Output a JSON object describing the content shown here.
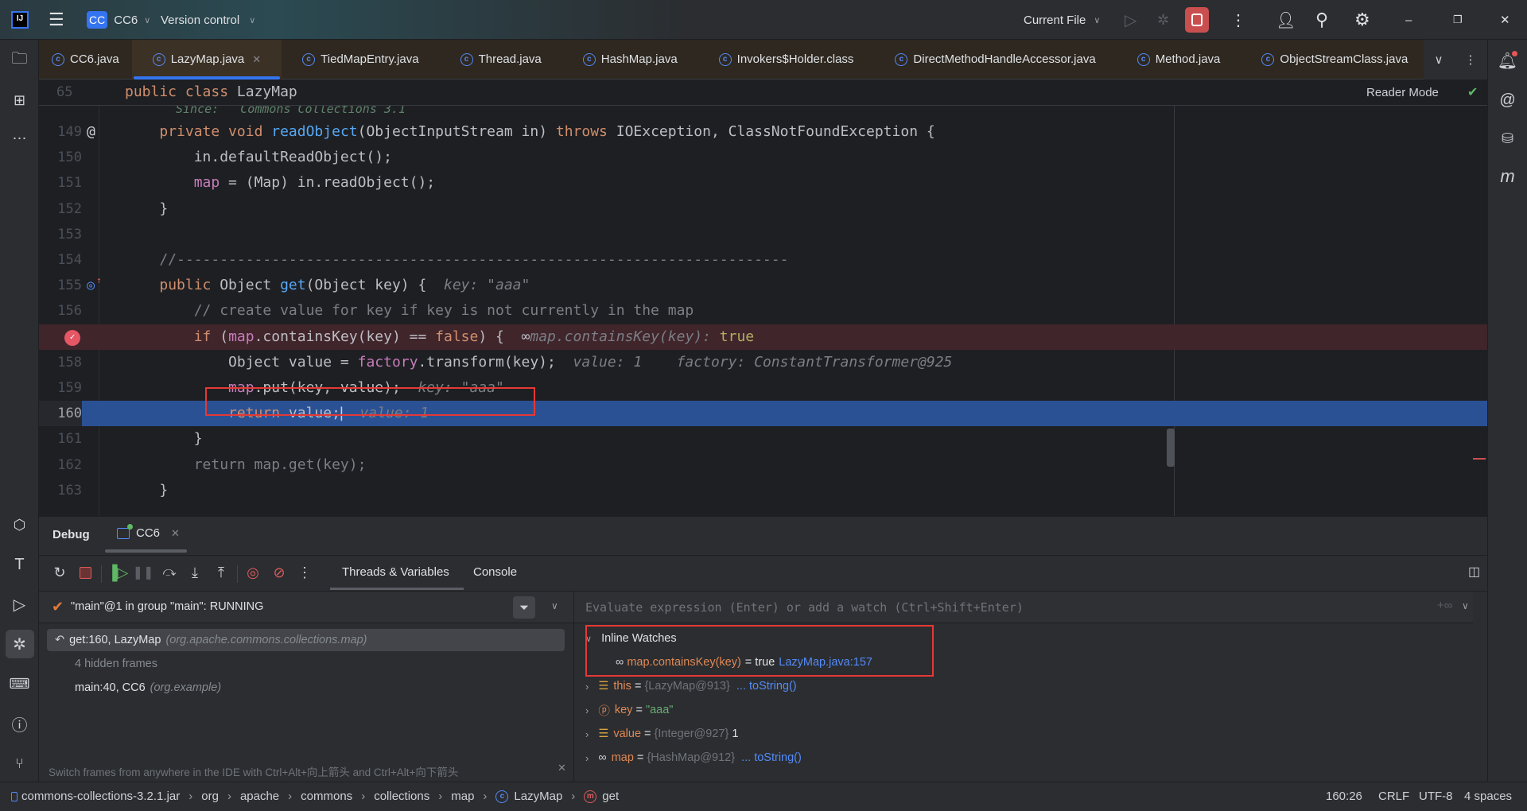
{
  "titlebar": {
    "logo": "IJ",
    "project_badge": "CC",
    "project": "CC6",
    "vcs": "Version control",
    "run_config": "Current File",
    "icons": [
      "hamburger-icon",
      "run-icon",
      "debug-icon",
      "stop-icon",
      "more-icon",
      "add-user-icon",
      "search-icon",
      "settings-icon",
      "minimize-icon",
      "restore-icon",
      "close-icon"
    ],
    "stop_color": "#c94f4f"
  },
  "tabs": [
    {
      "label": "CC6.java"
    },
    {
      "label": "LazyMap.java",
      "active": true
    },
    {
      "label": "TiedMapEntry.java"
    },
    {
      "label": "Thread.java"
    },
    {
      "label": "HashMap.java"
    },
    {
      "label": "Invokers$Holder.class"
    },
    {
      "label": "DirectMethodHandleAccessor.java"
    },
    {
      "label": "Method.java"
    },
    {
      "label": "ObjectStreamClass.java"
    }
  ],
  "editor": {
    "sticky_line_number": "65",
    "sticky_text": "public class LazyMap",
    "reader_mode": "Reader Mode",
    "doc_line": "Since:   Commons Collections 3.1",
    "lines": [
      {
        "n": "149",
        "gutter": "@",
        "tokens": [
          [
            "    ",
            "t"
          ],
          [
            "private void ",
            "k"
          ],
          [
            "readObject",
            "f"
          ],
          [
            "(ObjectInputStream in) ",
            "t"
          ],
          [
            "throws ",
            "k"
          ],
          [
            "IOException, ClassNotFoundException {",
            "t"
          ]
        ]
      },
      {
        "n": "150",
        "tokens": [
          [
            "        in.defaultReadObject();",
            "t"
          ]
        ]
      },
      {
        "n": "151",
        "tokens": [
          [
            "        ",
            "t"
          ],
          [
            "map",
            "v"
          ],
          [
            " = (Map) in.readObject();",
            "t"
          ]
        ]
      },
      {
        "n": "152",
        "tokens": [
          [
            "    }",
            "t"
          ]
        ]
      },
      {
        "n": "153",
        "tokens": []
      },
      {
        "n": "154",
        "tokens": [
          [
            "    //-----------------------------------------------------------------------",
            "c"
          ]
        ]
      },
      {
        "n": "155",
        "gutter": "override",
        "tokens": [
          [
            "    ",
            "t"
          ],
          [
            "public ",
            "k"
          ],
          [
            "Object ",
            "t"
          ],
          [
            "get",
            "f"
          ],
          [
            "(Object key) {  ",
            "t"
          ],
          [
            "key: \"aaa\"",
            "h"
          ]
        ]
      },
      {
        "n": "156",
        "tokens": [
          [
            "        // create value for key if key is not currently in the map",
            "c"
          ]
        ]
      },
      {
        "n": "",
        "gutter": "breakpoint",
        "style": "bp",
        "tokens": [
          [
            "        ",
            "t"
          ],
          [
            "if ",
            "k"
          ],
          [
            "(",
            "t"
          ],
          [
            "map",
            "v"
          ],
          [
            ".containsKey(key) == ",
            "t"
          ],
          [
            "false",
            "k"
          ],
          [
            ") {  ",
            "t"
          ],
          [
            "∞",
            "t"
          ],
          [
            "map.containsKey(key): ",
            "h"
          ],
          [
            "true",
            "y"
          ]
        ]
      },
      {
        "n": "158",
        "tokens": [
          [
            "            Object value = ",
            "t"
          ],
          [
            "factory",
            "v"
          ],
          [
            ".transform(key);  ",
            "t"
          ],
          [
            "value: 1    factory: ConstantTransformer@925",
            "h"
          ]
        ]
      },
      {
        "n": "159",
        "tokens": [
          [
            "            ",
            "t"
          ],
          [
            "map",
            "v"
          ],
          [
            ".put(key, value);  ",
            "t"
          ],
          [
            "key: \"aaa\"",
            "h"
          ]
        ]
      },
      {
        "n": "160",
        "style": "exec",
        "tokens": [
          [
            "            ",
            "t"
          ],
          [
            "return ",
            "k"
          ],
          [
            "value;",
            "t"
          ],
          [
            "|  ",
            "cur"
          ],
          [
            "value: 1",
            "h"
          ]
        ]
      },
      {
        "n": "161",
        "tokens": [
          [
            "        }",
            "t"
          ]
        ]
      },
      {
        "n": "162",
        "tokens": [
          [
            "        return map.get(key);",
            "g"
          ]
        ]
      },
      {
        "n": "163",
        "tokens": [
          [
            "    }",
            "t"
          ]
        ]
      }
    ]
  },
  "debug": {
    "title": "Debug",
    "session": "CC6",
    "toolbar": [
      "rerun-icon",
      "stop-icon",
      "resume-icon",
      "pause-icon",
      "step-over-icon",
      "step-into-icon",
      "step-out-icon",
      "view-breakpoints-icon",
      "mute-breakpoints-icon",
      "more-icon"
    ],
    "tabs": [
      "Threads & Variables",
      "Console"
    ],
    "thread": "\"main\"@1 in group \"main\": RUNNING",
    "frames": [
      {
        "method": "get:160, LazyMap",
        "pkg": "(org.apache.commons.collections.map)",
        "selected": true
      },
      {
        "method": "4 hidden frames",
        "pkg": ""
      },
      {
        "method": "main:40, CC6",
        "pkg": "(org.example)"
      }
    ],
    "hint": "Switch frames from anywhere in the IDE with Ctrl+Alt+向上箭头 and Ctrl+Alt+向下箭头",
    "eval_placeholder": "Evaluate expression (Enter) or add a watch (Ctrl+Shift+Enter)",
    "inline_watches": {
      "label": "Inline Watches",
      "expr": "map.containsKey(key)",
      "value": "= true",
      "location": "LazyMap.java:157"
    },
    "variables": [
      {
        "name": "this",
        "eq": " = ",
        "type": "{LazyMap@913}",
        "value": "",
        "link": "... toString()",
        "icon": "field"
      },
      {
        "name": "key",
        "eq": " = ",
        "type": "",
        "value": "\"aaa\"",
        "link": "",
        "icon": "param"
      },
      {
        "name": "value",
        "eq": " = ",
        "type": "{Integer@927}",
        "value": " 1",
        "link": "",
        "icon": "field"
      },
      {
        "name": "map",
        "eq": " = ",
        "type": "{HashMap@912}",
        "value": "",
        "link": "... toString()",
        "icon": "watch"
      }
    ]
  },
  "statusbar": {
    "crumbs": [
      "commons-collections-3.2.1.jar",
      "org",
      "apache",
      "commons",
      "collections",
      "map",
      "LazyMap",
      "get"
    ],
    "position": "160:26",
    "line_sep": "CRLF",
    "encoding": "UTF-8",
    "indent": "4 spaces"
  }
}
